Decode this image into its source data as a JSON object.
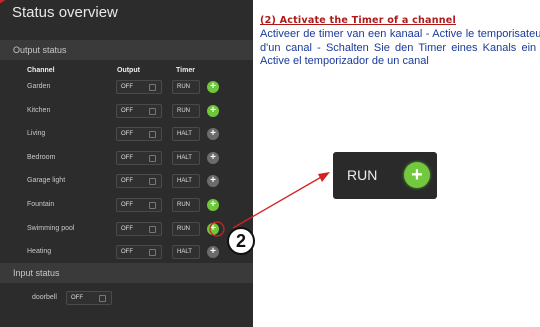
{
  "panel": {
    "title": "Status overview",
    "output_section": "Output status",
    "input_section": "Input status",
    "columns": {
      "channel": "Channel",
      "output": "Output",
      "timer": "Timer"
    },
    "rows": [
      {
        "label": "Garden",
        "output": "OFF",
        "timer": "RUN"
      },
      {
        "label": "Kitchen",
        "output": "OFF",
        "timer": "RUN"
      },
      {
        "label": "Living",
        "output": "OFF",
        "timer": "HALT"
      },
      {
        "label": "Bedroom",
        "output": "OFF",
        "timer": "HALT"
      },
      {
        "label": "Garage light",
        "output": "OFF",
        "timer": "HALT"
      },
      {
        "label": "Fountain",
        "output": "OFF",
        "timer": "RUN"
      },
      {
        "label": "Swimming pool",
        "output": "OFF",
        "timer": "RUN"
      },
      {
        "label": "Heating",
        "output": "OFF",
        "timer": "HALT"
      }
    ],
    "input_row": {
      "label": "doorbell",
      "state": "OFF"
    }
  },
  "badge": "2",
  "headline": "(2) Activate the Timer of a channel",
  "body": "Activeer de timer van een kanaal - Active le temporisateur d'un canal - Schalten Sie den Timer eines Kanals ein - Active el temporizador de un canal",
  "zoom": {
    "label": "RUN"
  },
  "colors": {
    "accent": "#6ec63a",
    "headline": "#b01818",
    "body": "#1a3a9a",
    "panel": "#2c2c2c"
  }
}
